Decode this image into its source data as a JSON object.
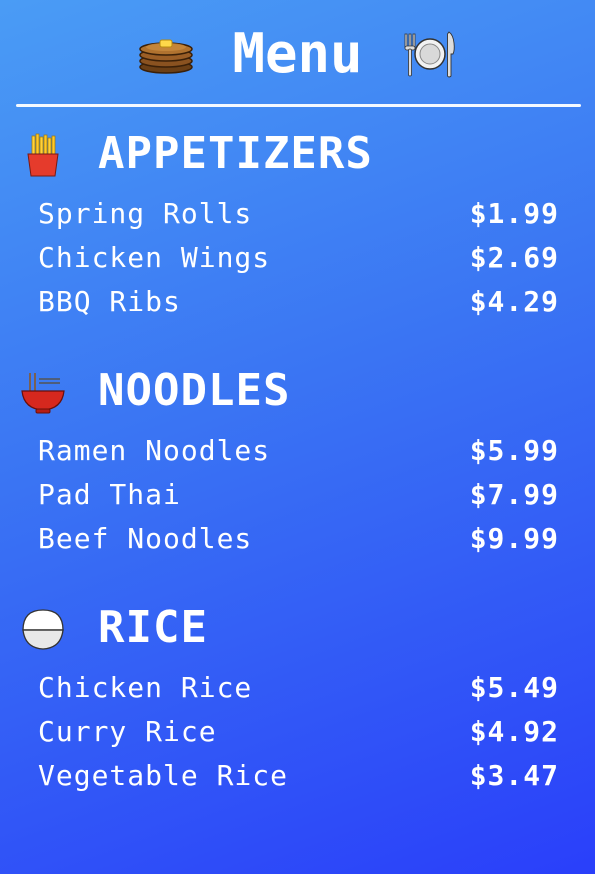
{
  "header": {
    "title": "Menu",
    "left_icon": "pancakes-icon",
    "right_icon": "fork-plate-knife-icon"
  },
  "colors": {
    "background_top": "#4a9cf5",
    "background_bottom": "#2a3ffa",
    "text": "#ffffff"
  },
  "sections": [
    {
      "title": "APPETIZERS",
      "icon": "fries-icon",
      "items": [
        {
          "name": "Spring Rolls",
          "price": "$1.99"
        },
        {
          "name": "Chicken Wings",
          "price": "$2.69"
        },
        {
          "name": "BBQ Ribs",
          "price": "$4.29"
        }
      ]
    },
    {
      "title": "NOODLES",
      "icon": "noodle-bowl-icon",
      "items": [
        {
          "name": "Ramen Noodles",
          "price": "$5.99"
        },
        {
          "name": "Pad Thai",
          "price": "$7.99"
        },
        {
          "name": "Beef Noodles",
          "price": "$9.99"
        }
      ]
    },
    {
      "title": "RICE",
      "icon": "rice-bowl-icon",
      "items": [
        {
          "name": "Chicken Rice",
          "price": "$5.49"
        },
        {
          "name": "Curry Rice",
          "price": "$4.92"
        },
        {
          "name": "Vegetable Rice",
          "price": "$3.47"
        }
      ]
    }
  ]
}
